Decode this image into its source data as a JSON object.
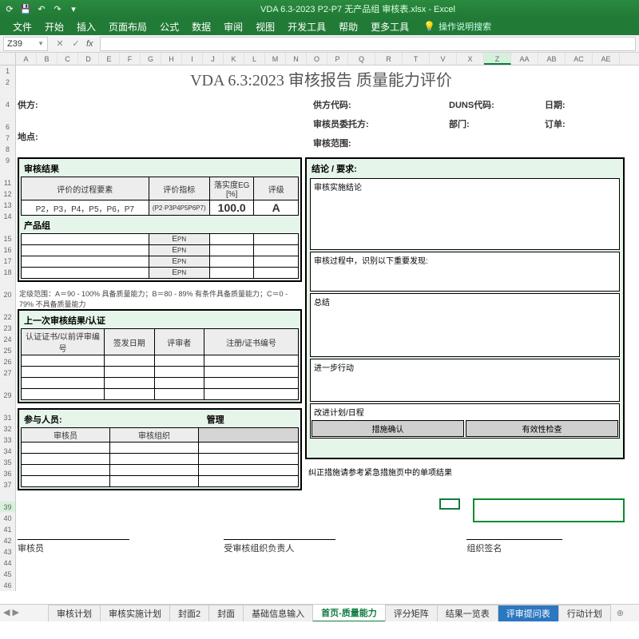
{
  "app": {
    "window_title": "VDA 6.3-2023 P2-P7 无产品组 审核表.xlsx  -  Excel"
  },
  "ribbon": {
    "tabs": [
      "文件",
      "开始",
      "插入",
      "页面布局",
      "公式",
      "数据",
      "审阅",
      "视图",
      "开发工具",
      "帮助",
      "更多工具"
    ],
    "hint": "操作说明搜索"
  },
  "namebox": "Z39",
  "columns": [
    "A",
    "B",
    "C",
    "D",
    "E",
    "F",
    "G",
    "H",
    "I",
    "J",
    "K",
    "L",
    "M",
    "N",
    "O",
    "P",
    "Q",
    "R",
    "T",
    "V",
    "X",
    "Z",
    "AA",
    "AB",
    "AC",
    "AE"
  ],
  "sel_col": "Z",
  "rows": [
    "1",
    "2",
    "",
    "4",
    "",
    "6",
    "7",
    "8",
    "9",
    "",
    "11",
    "12",
    "13",
    "14",
    "",
    "15",
    "16",
    "17",
    "18",
    "",
    "20",
    "",
    "22",
    "23",
    "24",
    "25",
    "26",
    "27",
    "",
    "29",
    "",
    "31",
    "32",
    "33",
    "34",
    "35",
    "36",
    "37",
    "",
    "39",
    "40",
    "41",
    "42",
    "43",
    "44",
    "45",
    "46"
  ],
  "report": {
    "title": "VDA 6.3:2023 审核报告  质量能力评价",
    "info_labels": {
      "supplier": "供方:",
      "location": "地点:",
      "supplier_code": "供方代码:",
      "auditor_client": "审核员委托方:",
      "audit_scope": "审核范围:",
      "duns": "DUNS代码:",
      "dept": "部门:",
      "date": "日期:",
      "order": "订单:"
    },
    "audit_result": {
      "panel_title": "审核结果",
      "col_elements": "评价的过程要素",
      "col_indicator": "评价指标",
      "col_eg": "落实度EG [%]",
      "col_grade": "评级",
      "elements_value": "P2，P3，P4，P5，P6，P7",
      "indicator_value": "(P2·P3P4P5P6P7)",
      "eg_value": "100.0",
      "grade_value": "A",
      "product_group_title": "产品组",
      "epn": "E",
      "epn_sub": "PN",
      "legend": "定级范围：A＝90 - 100% 具备质量能力；B＝80 - 89% 有条件具备质量能力；C＝0 - 79% 不具备质量能力"
    },
    "prev_audit": {
      "panel_title": "上一次审核结果/认证",
      "col_cert": "认证证书/以前评审编号",
      "col_date": "签发日期",
      "col_auditor": "评审者",
      "col_notes": "注册/证书编号"
    },
    "participants": {
      "panel_title": "参与人员:",
      "col_auditor": "审核员",
      "col_org": "审核组织",
      "col_manager": "管理"
    },
    "conclusions": {
      "panel_title": "结论 / 要求:",
      "box1": "审核实施结论",
      "box2": "审核过程中，识别以下重要发现:",
      "box3": "总结",
      "box4": "进一步行动",
      "box5": "改进计划/日程",
      "btn1": "措施确认",
      "btn2": "有效性检查",
      "note": "纠正措施请参考紧急措施页中的单项结果"
    },
    "signatures": {
      "auditor": "审核员",
      "auditee": "受审核组织负责人",
      "org_sign": "组织签名"
    }
  },
  "sheet_tabs": {
    "tabs": [
      "审核计划",
      "审核实施计划",
      "封面2",
      "封面",
      "基础信息输入",
      "首页-质量能力",
      "评分矩阵",
      "结果一览表",
      "评审提问表",
      "行动计划"
    ],
    "active": "首页-质量能力",
    "alt": "评审提问表"
  }
}
